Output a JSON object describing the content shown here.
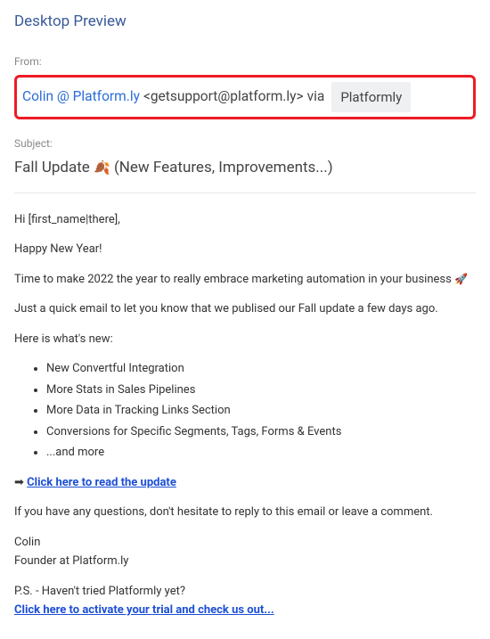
{
  "preview_title": "Desktop Preview",
  "labels": {
    "from": "From:",
    "subject": "Subject:"
  },
  "from": {
    "name": "Colin @ Platform.ly",
    "email": "<getsupport@platform.ly>",
    "via": "via",
    "badge": "Platformly"
  },
  "subject": {
    "prefix": "Fall Update ",
    "emoji": "🍂",
    "suffix": " (New Features, Improvements...)"
  },
  "body": {
    "greeting": "Hi [first_name|there],",
    "hny": "Happy New Year!",
    "intro_a": "Time to make 2022 the year to really embrace marketing automation in your business ",
    "rocket": "🚀",
    "line2": "Just a quick email to let you know that we publised our Fall update a few days ago.",
    "whatsnew": "Here is what's new:",
    "items": [
      "New Convertful Integration",
      "More Stats in Sales Pipelines",
      "More Data in Tracking Links Section",
      "Conversions for Specific Segments, Tags, Forms & Events",
      "...and more"
    ],
    "cta_arrow": "➡ ",
    "cta_link": "Click here to read the update",
    "questions": "If you have any questions, don't hesitate to reply to this email or leave a comment.",
    "sig_name": "Colin",
    "sig_title": "Founder at Platform.ly",
    "ps": "P.S. - Haven't tried Platformly yet?",
    "ps_link": "Click here to activate your trial and check us out..."
  }
}
